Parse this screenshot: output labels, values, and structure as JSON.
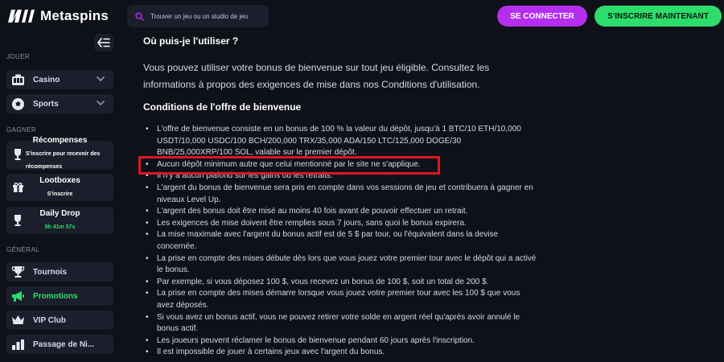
{
  "header": {
    "logo_text": "Metaspins",
    "search_placeholder": "Trouver un jeu ou un studio de jeu",
    "login_label": "SE CONNECTER",
    "signup_label": "S'INSCRIRE MAINTENANT"
  },
  "sidebar": {
    "section_play": "JOUER",
    "casino": "Casino",
    "sports": "Sports",
    "section_earn": "GAGNER",
    "rewards_title": "Récompenses",
    "rewards_sub": "S'inscrire pour recevoir des récompenses",
    "lootboxes_title": "Lootboxes",
    "lootboxes_sub": "S'inscrire",
    "daily_drop_title": "Daily Drop",
    "daily_drop_timer": "9h 41m 57s",
    "section_general": "GÉNÉRAL",
    "tournaments": "Tournois",
    "promotions": "Promotions",
    "vip": "VIP Club",
    "level_up": "Passage de Ni..."
  },
  "content": {
    "where_title": "Où puis-je l'utiliser ?",
    "where_text": "Vous pouvez utiliser votre bonus de bienvenue sur tout jeu éligible. Consultez les informations à propos des exigences de mise dans nos Conditions d'utilisation.",
    "conditions_title": "Conditions de l'offre de bienvenue",
    "conditions": [
      "L'offre de bienvenue consiste en un bonus de 100 % la valeur du dépôt, jusqu'à 1 BTC/10 ETH/10,000 USDT/10,000 USDC/100 BCH/200,000 TRX/35,000 ADA/150 LTC/125,000 DOGE/30 BNB/25,000XRP/100 SOL, valable sur le premier dépôt.",
      "Aucun dépôt minimum autre que celui mentionné par le site ne s'applique.",
      "Il n'y a aucun plafond sur les gains ou les retraits.",
      "L'argent du bonus de bienvenue sera pris en compte dans vos sessions de jeu et contribuera à gagner en niveaux Level Up.",
      "L'argent des bonus doit être misé au moins 40 fois avant de pouvoir effectuer un retrait.",
      "Les exigences de mise doivent être remplies sous 7 jours, sans quoi le bonus expirera.",
      "La mise maximale avec l'argent du bonus actif est de 5 $ par tour, ou l'équivalent dans la devise concernée.",
      "La prise en compte des mises débute dès lors que vous jouez votre premier tour avec le dépôt qui a activé le bonus.",
      "Par exemple, si vous déposez 100 $, vous recevez un bonus de 100 $, soit un total de 200 $.",
      "La prise en compte des mises démarre lorsque vous jouez votre premier tour avec les 100 $ que vous avez déposés.",
      "Si vous avez un bonus actif, vous ne pouvez retirer votre solde en argent réel qu'après avoir annulé le bonus actif.",
      "Les joueurs peuvent réclamer le bonus de bienvenue pendant 60 jours après l'inscription.",
      "Il est impossible de jouer à certains jeux avec l'argent du bonus."
    ]
  },
  "colors": {
    "accent_purple": "#b42ef0",
    "accent_green": "#2ddd6c",
    "highlight_red": "#e0161f",
    "background": "#0f1119",
    "panel": "#1b1e2b"
  }
}
